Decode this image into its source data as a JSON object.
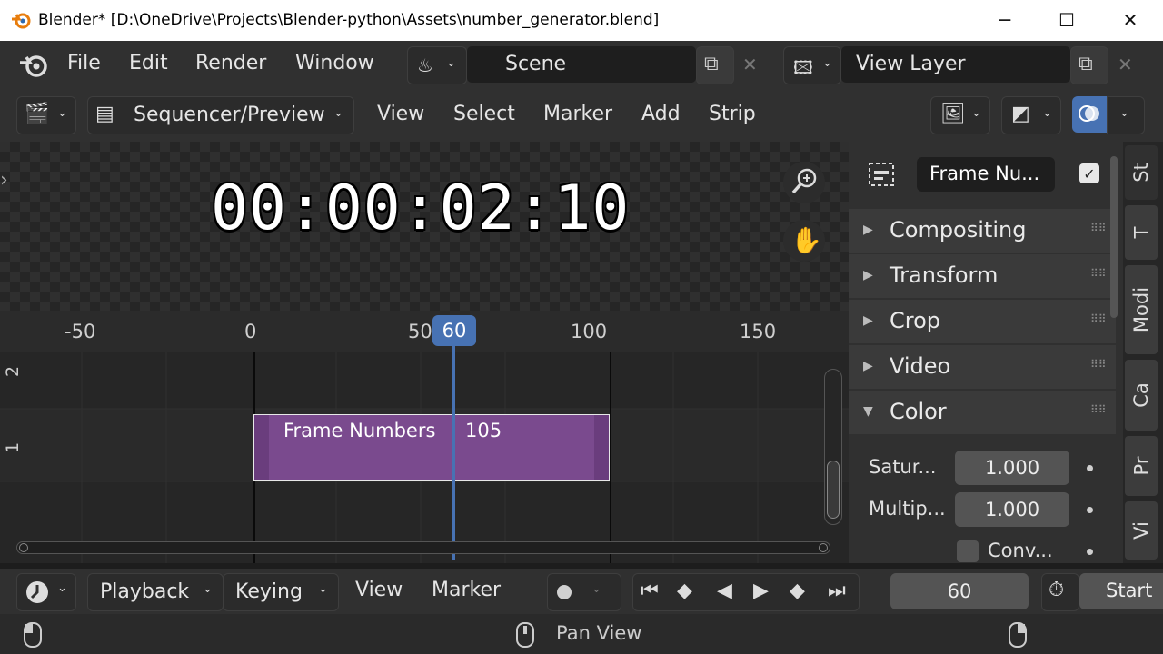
{
  "window": {
    "title": "Blender* [D:\\OneDrive\\Projects\\Blender-python\\Assets\\number_generator.blend]",
    "minimize": "─",
    "maximize": "☐",
    "close": "✕"
  },
  "topbar": {
    "menus": [
      "File",
      "Edit",
      "Render",
      "Window"
    ],
    "scene": "Scene",
    "view_layer": "View Layer"
  },
  "editor_header": {
    "mode": "Sequencer/Preview",
    "menus": [
      "View",
      "Select",
      "Marker",
      "Add",
      "Strip"
    ]
  },
  "preview": {
    "timecode": "00:00:02:10"
  },
  "sequencer": {
    "ruler": [
      "-50",
      "0",
      "50",
      "100",
      "150"
    ],
    "current_frame": "60",
    "channels": [
      "2",
      "1"
    ],
    "strip": {
      "name": "Frame Numbers",
      "length": "105",
      "color": "#7a4a8e"
    }
  },
  "sidebar": {
    "strip_name": "Frame Nu...",
    "panels": [
      "Compositing",
      "Transform",
      "Crop",
      "Video",
      "Color"
    ],
    "properties": [
      {
        "label": "Satur...",
        "value": "1.000"
      },
      {
        "label": "Multip...",
        "value": "1.000"
      }
    ],
    "checkbox_label": "Conv...",
    "tabs": [
      "St",
      "T",
      "Modi",
      "Ca",
      "Pr",
      "Vi"
    ]
  },
  "timeline": {
    "menus": [
      "Playback",
      "Keying",
      "View",
      "Marker"
    ],
    "frame": "60",
    "start_label": "Start"
  },
  "statusbar": {
    "middle": "Pan View"
  },
  "colors": {
    "accent": "#4772b3",
    "strip": "#7a4a8e"
  }
}
